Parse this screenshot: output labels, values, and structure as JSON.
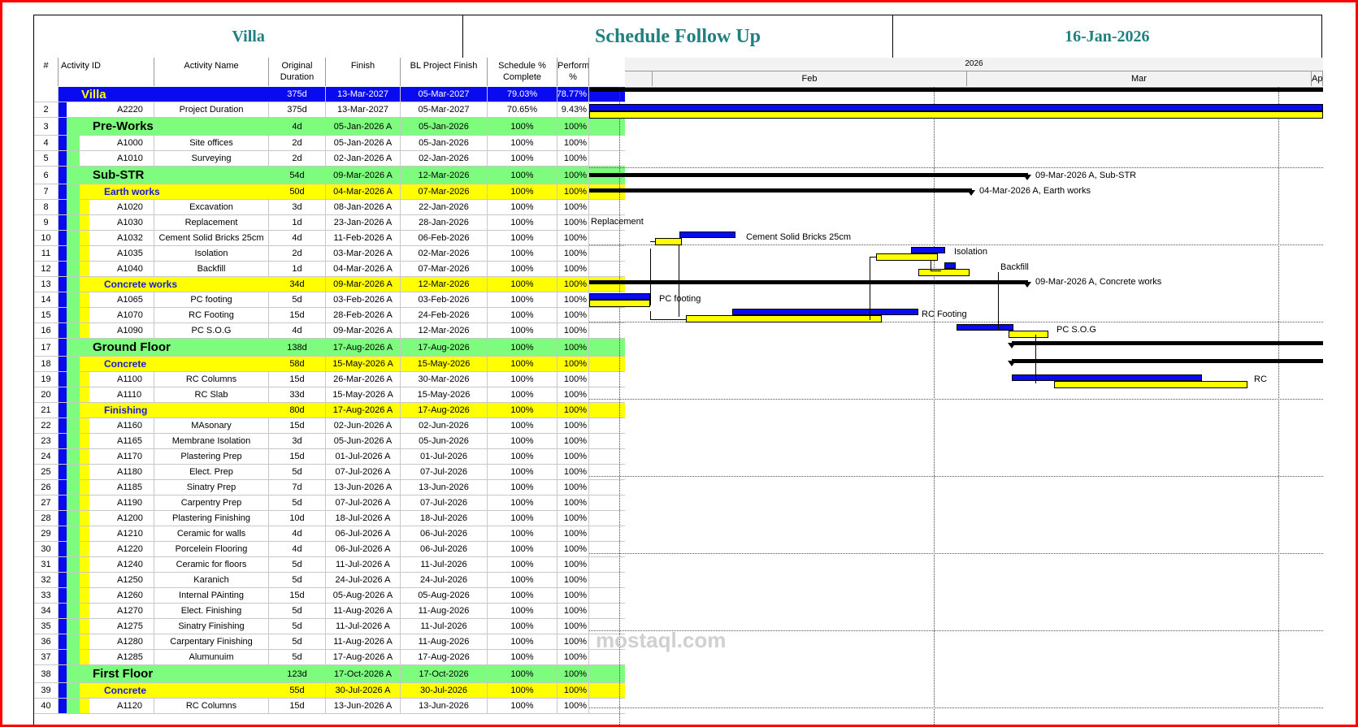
{
  "header": {
    "project": "Villa",
    "title": "Schedule Follow Up",
    "date": "16-Jan-2026"
  },
  "columns": {
    "num": "#",
    "id": "Activity ID",
    "name": "Activity Name",
    "od": "Original Duration",
    "finish": "Finish",
    "bl_finish": "BL Project Finish",
    "sched": "Schedule % Complete",
    "perf": "Performance %"
  },
  "timescale": {
    "year": "2026",
    "months": [
      "Feb",
      "Mar",
      "Apr"
    ]
  },
  "colors": {
    "wbs0": "#0a0af0",
    "wbs1": "#7dfc7d",
    "wbs2": "#ffff00",
    "bar_actual": "#0a0af0",
    "bar_baseline": "#ffff00"
  },
  "rows": [
    {
      "n": "1",
      "type": "wbs0",
      "name": "Villa",
      "od": "375d",
      "fin": "13-Mar-2027",
      "bl": "05-Mar-2027",
      "sc": "79.03%",
      "pf": "78.77%"
    },
    {
      "n": "2",
      "type": "act",
      "id": "A2220",
      "name": "Project Duration",
      "od": "375d",
      "fin": "13-Mar-2027",
      "bl": "05-Mar-2027",
      "sc": "70.65%",
      "pf": "9.43%"
    },
    {
      "n": "3",
      "type": "wbs1",
      "name": "Pre-Works",
      "od": "4d",
      "fin": "05-Jan-2026 A",
      "bl": "05-Jan-2026",
      "sc": "100%",
      "pf": "100%"
    },
    {
      "n": "4",
      "type": "act",
      "id": "A1000",
      "name": "Site offices",
      "od": "2d",
      "fin": "05-Jan-2026 A",
      "bl": "05-Jan-2026",
      "sc": "100%",
      "pf": "100%"
    },
    {
      "n": "5",
      "type": "act",
      "id": "A1010",
      "name": "Surveying",
      "od": "2d",
      "fin": "02-Jan-2026 A",
      "bl": "02-Jan-2026",
      "sc": "100%",
      "pf": "100%"
    },
    {
      "n": "6",
      "type": "wbs1",
      "name": "Sub-STR",
      "od": "54d",
      "fin": "09-Mar-2026 A",
      "bl": "12-Mar-2026",
      "sc": "100%",
      "pf": "100%"
    },
    {
      "n": "7",
      "type": "wbs2",
      "name": "Earth works",
      "od": "50d",
      "fin": "04-Mar-2026 A",
      "bl": "07-Mar-2026",
      "sc": "100%",
      "pf": "100%"
    },
    {
      "n": "8",
      "type": "act",
      "id": "A1020",
      "name": "Excavation",
      "od": "3d",
      "fin": "08-Jan-2026 A",
      "bl": "22-Jan-2026",
      "sc": "100%",
      "pf": "100%"
    },
    {
      "n": "9",
      "type": "act",
      "id": "A1030",
      "name": "Replacement",
      "od": "1d",
      "fin": "23-Jan-2026 A",
      "bl": "28-Jan-2026",
      "sc": "100%",
      "pf": "100%"
    },
    {
      "n": "10",
      "type": "act",
      "id": "A1032",
      "name": "Cement Solid Bricks 25cm",
      "od": "4d",
      "fin": "11-Feb-2026 A",
      "bl": "06-Feb-2026",
      "sc": "100%",
      "pf": "100%"
    },
    {
      "n": "11",
      "type": "act",
      "id": "A1035",
      "name": "Isolation",
      "od": "2d",
      "fin": "03-Mar-2026 A",
      "bl": "02-Mar-2026",
      "sc": "100%",
      "pf": "100%"
    },
    {
      "n": "12",
      "type": "act",
      "id": "A1040",
      "name": "Backfill",
      "od": "1d",
      "fin": "04-Mar-2026 A",
      "bl": "07-Mar-2026",
      "sc": "100%",
      "pf": "100%"
    },
    {
      "n": "13",
      "type": "wbs2",
      "name": "Concrete works",
      "od": "34d",
      "fin": "09-Mar-2026 A",
      "bl": "12-Mar-2026",
      "sc": "100%",
      "pf": "100%"
    },
    {
      "n": "14",
      "type": "act",
      "id": "A1065",
      "name": "PC footing",
      "od": "5d",
      "fin": "03-Feb-2026 A",
      "bl": "03-Feb-2026",
      "sc": "100%",
      "pf": "100%"
    },
    {
      "n": "15",
      "type": "act",
      "id": "A1070",
      "name": "RC Footing",
      "od": "15d",
      "fin": "28-Feb-2026 A",
      "bl": "24-Feb-2026",
      "sc": "100%",
      "pf": "100%"
    },
    {
      "n": "16",
      "type": "act",
      "id": "A1090",
      "name": "PC S.O.G",
      "od": "4d",
      "fin": "09-Mar-2026 A",
      "bl": "12-Mar-2026",
      "sc": "100%",
      "pf": "100%"
    },
    {
      "n": "17",
      "type": "wbs1",
      "name": "Ground Floor",
      "od": "138d",
      "fin": "17-Aug-2026 A",
      "bl": "17-Aug-2026",
      "sc": "100%",
      "pf": "100%"
    },
    {
      "n": "18",
      "type": "wbs2",
      "name": "Concrete",
      "od": "58d",
      "fin": "15-May-2026 A",
      "bl": "15-May-2026",
      "sc": "100%",
      "pf": "100%"
    },
    {
      "n": "19",
      "type": "act",
      "id": "A1100",
      "name": "RC Columns",
      "od": "15d",
      "fin": "26-Mar-2026 A",
      "bl": "30-Mar-2026",
      "sc": "100%",
      "pf": "100%"
    },
    {
      "n": "20",
      "type": "act",
      "id": "A1110",
      "name": "RC Slab",
      "od": "33d",
      "fin": "15-May-2026 A",
      "bl": "15-May-2026",
      "sc": "100%",
      "pf": "100%"
    },
    {
      "n": "21",
      "type": "wbs2",
      "name": "Finishing",
      "od": "80d",
      "fin": "17-Aug-2026 A",
      "bl": "17-Aug-2026",
      "sc": "100%",
      "pf": "100%"
    },
    {
      "n": "22",
      "type": "act",
      "id": "A1160",
      "name": "MAsonary",
      "od": "15d",
      "fin": "02-Jun-2026 A",
      "bl": "02-Jun-2026",
      "sc": "100%",
      "pf": "100%"
    },
    {
      "n": "23",
      "type": "act",
      "id": "A1165",
      "name": "Membrane Isolation",
      "od": "3d",
      "fin": "05-Jun-2026 A",
      "bl": "05-Jun-2026",
      "sc": "100%",
      "pf": "100%"
    },
    {
      "n": "24",
      "type": "act",
      "id": "A1170",
      "name": "Plastering Prep",
      "od": "15d",
      "fin": "01-Jul-2026 A",
      "bl": "01-Jul-2026",
      "sc": "100%",
      "pf": "100%"
    },
    {
      "n": "25",
      "type": "act",
      "id": "A1180",
      "name": "Elect. Prep",
      "od": "5d",
      "fin": "07-Jul-2026 A",
      "bl": "07-Jul-2026",
      "sc": "100%",
      "pf": "100%"
    },
    {
      "n": "26",
      "type": "act",
      "id": "A1185",
      "name": "Sinatry Prep",
      "od": "7d",
      "fin": "13-Jun-2026 A",
      "bl": "13-Jun-2026",
      "sc": "100%",
      "pf": "100%"
    },
    {
      "n": "27",
      "type": "act",
      "id": "A1190",
      "name": "Carpentry Prep",
      "od": "5d",
      "fin": "07-Jul-2026 A",
      "bl": "07-Jul-2026",
      "sc": "100%",
      "pf": "100%"
    },
    {
      "n": "28",
      "type": "act",
      "id": "A1200",
      "name": "Plastering Finishing",
      "od": "10d",
      "fin": "18-Jul-2026 A",
      "bl": "18-Jul-2026",
      "sc": "100%",
      "pf": "100%"
    },
    {
      "n": "29",
      "type": "act",
      "id": "A1210",
      "name": "Ceramic for walls",
      "od": "4d",
      "fin": "06-Jul-2026 A",
      "bl": "06-Jul-2026",
      "sc": "100%",
      "pf": "100%"
    },
    {
      "n": "30",
      "type": "act",
      "id": "A1220",
      "name": "Porcelein Flooring",
      "od": "4d",
      "fin": "06-Jul-2026 A",
      "bl": "06-Jul-2026",
      "sc": "100%",
      "pf": "100%"
    },
    {
      "n": "31",
      "type": "act",
      "id": "A1240",
      "name": "Ceramic for floors",
      "od": "5d",
      "fin": "11-Jul-2026 A",
      "bl": "11-Jul-2026",
      "sc": "100%",
      "pf": "100%"
    },
    {
      "n": "32",
      "type": "act",
      "id": "A1250",
      "name": "Karanich",
      "od": "5d",
      "fin": "24-Jul-2026 A",
      "bl": "24-Jul-2026",
      "sc": "100%",
      "pf": "100%"
    },
    {
      "n": "33",
      "type": "act",
      "id": "A1260",
      "name": "Internal PAinting",
      "od": "15d",
      "fin": "05-Aug-2026 A",
      "bl": "05-Aug-2026",
      "sc": "100%",
      "pf": "100%"
    },
    {
      "n": "34",
      "type": "act",
      "id": "A1270",
      "name": "Elect. Finishing",
      "od": "5d",
      "fin": "11-Aug-2026 A",
      "bl": "11-Aug-2026",
      "sc": "100%",
      "pf": "100%"
    },
    {
      "n": "35",
      "type": "act",
      "id": "A1275",
      "name": "Sinatry Finishing",
      "od": "5d",
      "fin": "11-Jul-2026 A",
      "bl": "11-Jul-2026",
      "sc": "100%",
      "pf": "100%"
    },
    {
      "n": "36",
      "type": "act",
      "id": "A1280",
      "name": "Carpentary Finishing",
      "od": "5d",
      "fin": "11-Aug-2026 A",
      "bl": "11-Aug-2026",
      "sc": "100%",
      "pf": "100%"
    },
    {
      "n": "37",
      "type": "act",
      "id": "A1285",
      "name": "Alumunuim",
      "od": "5d",
      "fin": "17-Aug-2026 A",
      "bl": "17-Aug-2026",
      "sc": "100%",
      "pf": "100%"
    },
    {
      "n": "38",
      "type": "wbs1",
      "name": "First Floor",
      "od": "123d",
      "fin": "17-Oct-2026 A",
      "bl": "17-Oct-2026",
      "sc": "100%",
      "pf": "100%"
    },
    {
      "n": "39",
      "type": "wbs2",
      "name": "Concrete",
      "od": "55d",
      "fin": "30-Jul-2026 A",
      "bl": "30-Jul-2026",
      "sc": "100%",
      "pf": "100%"
    },
    {
      "n": "40",
      "type": "act",
      "id": "A1120",
      "name": "RC Columns",
      "od": "15d",
      "fin": "13-Jun-2026 A",
      "bl": "13-Jun-2026",
      "sc": "100%",
      "pf": "100%"
    }
  ],
  "gantt_labels": {
    "sub_str": "09-Mar-2026 A, Sub-STR",
    "earth_works": "04-Mar-2026 A, Earth works",
    "replacement": "Replacement",
    "cement": "Cement Solid Bricks 25cm",
    "isolation": "Isolation",
    "backfill": "Backfill",
    "concrete_works": "09-Mar-2026 A, Concrete works",
    "pc_footing": "PC footing",
    "rc_footing": "RC Footing",
    "pc_sog": "PC S.O.G",
    "rc": "RC"
  },
  "watermark": "mostaql.com"
}
